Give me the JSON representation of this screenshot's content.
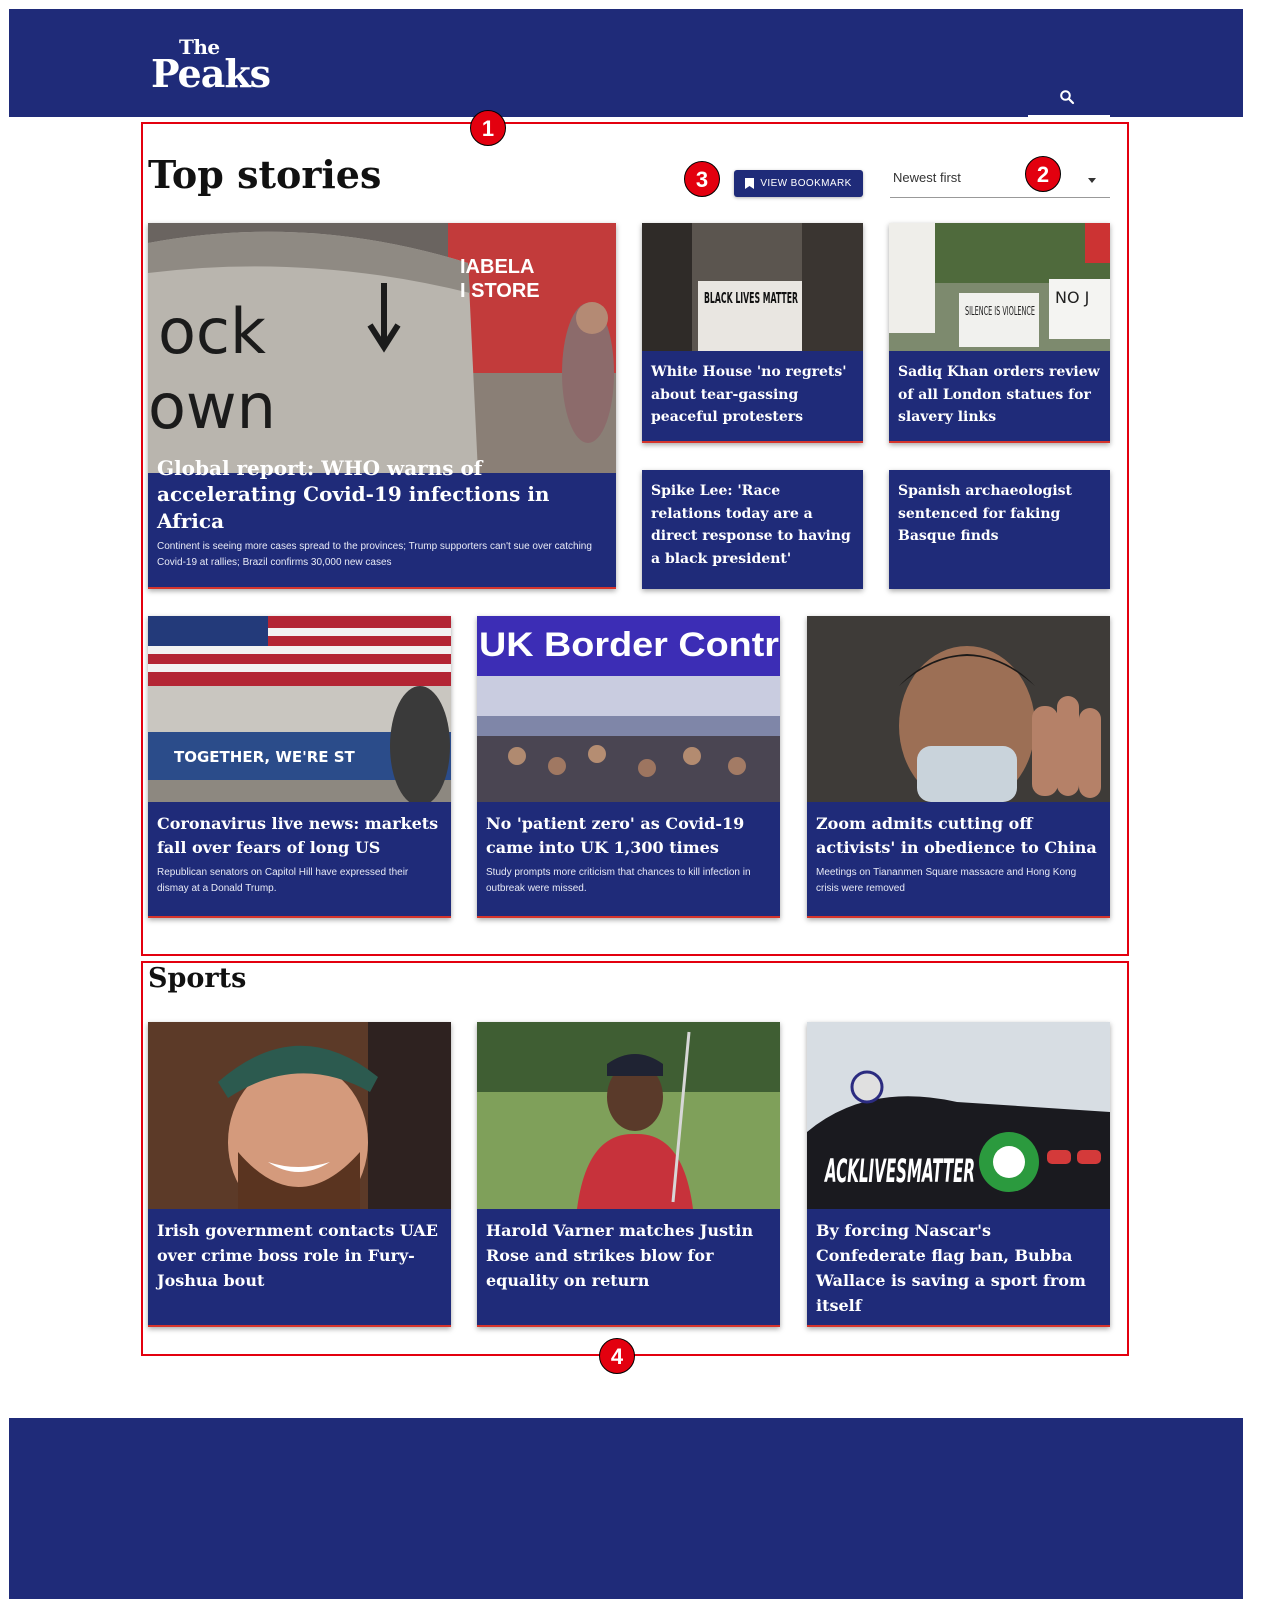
{
  "header": {
    "logo_the": "The",
    "logo_peaks": "Peaks",
    "search_icon": "search-icon"
  },
  "annotations": [
    "1",
    "2",
    "3",
    "4"
  ],
  "top_stories": {
    "title": "Top stories",
    "bookmark_label": "VIEW BOOKMARK",
    "sort_value": "Newest first",
    "featured": {
      "headline": "Global report: WHO warns of accelerating Covid-19 infections in Africa",
      "summary": "Continent is seeing more cases spread to the provinces; Trump supporters can't sue over catching Covid-19 at rallies; Brazil confirms 30,000 new cases"
    },
    "small": [
      {
        "headline": "White House 'no regrets' about tear-gassing peaceful protesters"
      },
      {
        "headline": "Sadiq Khan orders review of all London statues for slavery links"
      },
      {
        "headline": "Spike Lee: 'Race relations today are a direct response to having a black president'"
      },
      {
        "headline": "Spanish archaeologist sentenced for faking Basque finds"
      }
    ],
    "row": [
      {
        "headline": "Coronavirus live news: markets fall over fears of long US",
        "summary": "Republican senators on Capitol Hill have expressed their dismay at a Donald Trump."
      },
      {
        "headline": "No 'patient zero' as Covid-19 came into UK 1,300 times",
        "summary": "Study prompts more criticism that chances to kill infection in outbreak were missed."
      },
      {
        "headline": "Zoom admits cutting off activists' in obedience to China",
        "summary": "Meetings on Tiananmen Square massacre and Hong Kong crisis were removed"
      }
    ]
  },
  "sports": {
    "title": "Sports",
    "cards": [
      {
        "headline": "Irish government contacts UAE over crime boss role in Fury-Joshua bout"
      },
      {
        "headline": "Harold Varner matches Justin Rose and strikes blow for equality on return"
      },
      {
        "headline": "By forcing Nascar's Confederate flag ban, Bubba Wallace is saving a sport from itself"
      }
    ]
  },
  "image_text": {
    "store_sign_1": "IABELA",
    "store_sign_2": "I STORE",
    "graffiti_1": "ock",
    "graffiti_2": "own",
    "blm_sign": "BLACK LIVES MATTER",
    "protest_sign": "SILENCE IS VIOLENCE",
    "protest_sign_2": "NO J",
    "exchange_banner": "TOGETHER, WE'RE ST",
    "border_sign": "UK Border Contr",
    "car_text": "ACKLIVESMATTER"
  },
  "colors": {
    "brand": "#1f2b79",
    "annotation": "#e3000f"
  }
}
